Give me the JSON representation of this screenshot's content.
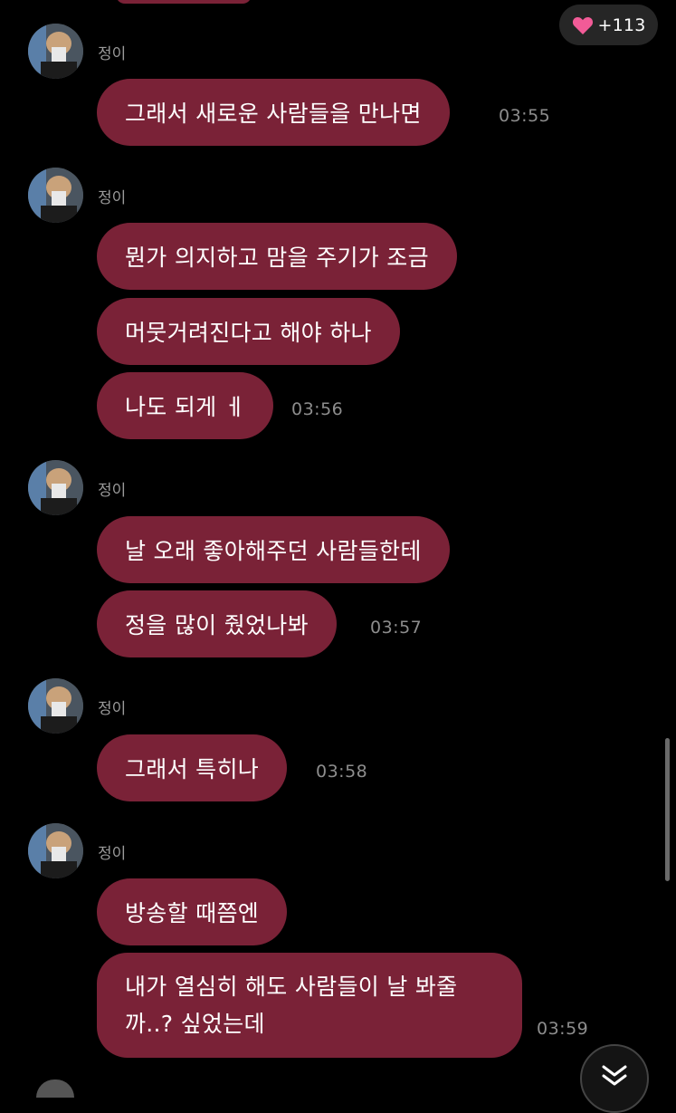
{
  "likes": {
    "count_label": "+113",
    "icon": "heart-icon",
    "heart_color": "#f25b97"
  },
  "colors": {
    "bubble": "#7a2237",
    "background": "#000000",
    "timestamp": "#8d8d8d",
    "sender_name": "#9a9a9a"
  },
  "groups": [
    {
      "sender": "정이",
      "messages": [
        "그래서 새로운 사람들을 만나면"
      ],
      "time": "03:55"
    },
    {
      "sender": "정이",
      "messages": [
        "뭔가 의지하고 맘을 주기가 조금",
        "머뭇거려진다고 해야 하나",
        "나도 되게 ㅔ"
      ],
      "time": "03:56"
    },
    {
      "sender": "정이",
      "messages": [
        "날 오래 좋아해주던 사람들한테",
        "정을 많이 줬었나봐"
      ],
      "time": "03:57"
    },
    {
      "sender": "정이",
      "messages": [
        "그래서 특히나"
      ],
      "time": "03:58"
    },
    {
      "sender": "정이",
      "messages": [
        "방송할 때쯤엔",
        "내가 열심히 해도 사람들이 날 봐줄까..? 싶었는데"
      ],
      "time": "03:59"
    }
  ],
  "scroll_down_icon": "double-chevron-down-icon"
}
